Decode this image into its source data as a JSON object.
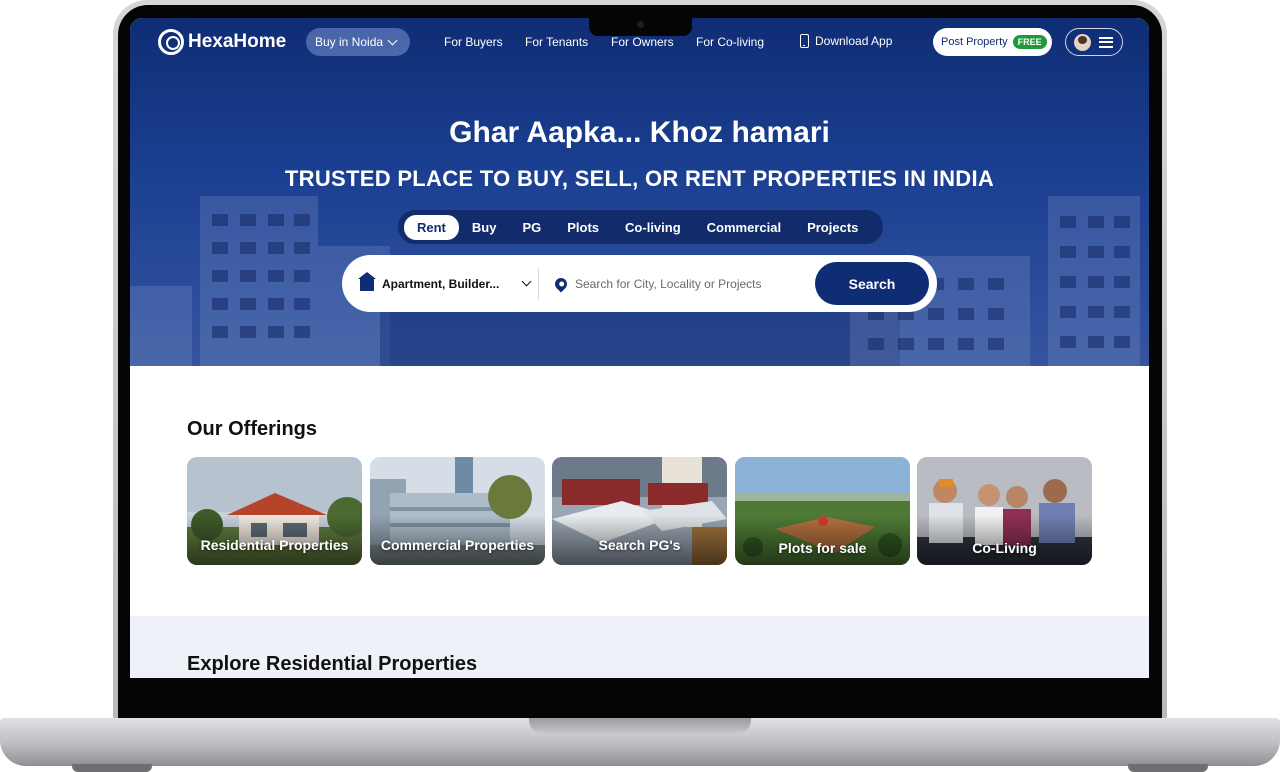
{
  "header": {
    "logo_text": "HexaHome",
    "city_select": "Buy in Noida",
    "nav_links": [
      "For Buyers",
      "For Tenants",
      "For Owners",
      "For Co-living"
    ],
    "download_app": "Download App",
    "post_property": "Post Property",
    "post_property_badge": "FREE"
  },
  "hero": {
    "title": "Ghar Aapka... Khoz hamari",
    "subtitle": "TRUSTED PLACE TO BUY, SELL, OR RENT PROPERTIES IN INDIA",
    "tabs": [
      "Rent",
      "Buy",
      "PG",
      "Plots",
      "Co-living",
      "Commercial",
      "Projects"
    ],
    "active_tab": "Rent"
  },
  "search": {
    "property_type": "Apartment, Builder...",
    "location_placeholder": "Search for City, Locality or Projects",
    "button_label": "Search"
  },
  "offerings": {
    "title": "Our Offerings",
    "cards": [
      "Residential Properties",
      "Commercial Properties",
      "Search PG's",
      "Plots for sale",
      "Co-Living"
    ]
  },
  "explore": {
    "title": "Explore Residential Properties"
  },
  "colors": {
    "brand_navy": "#0f2d74",
    "free_badge": "#1f9a3b"
  }
}
